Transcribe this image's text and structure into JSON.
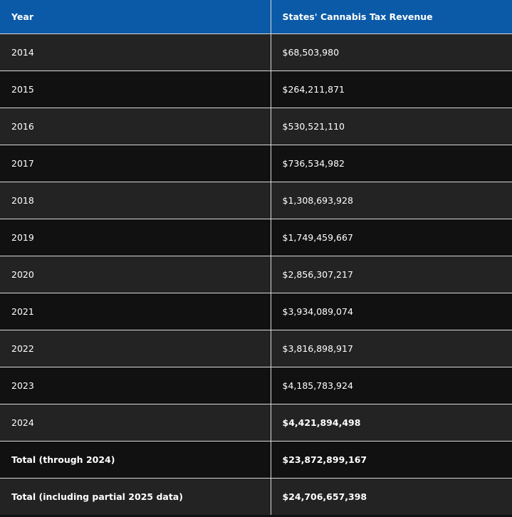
{
  "table": {
    "headers": [
      "Year",
      "States' Cannabis Tax Revenue"
    ],
    "rows": [
      {
        "year": "2014",
        "revenue": "$68,503,980",
        "bold_year": false,
        "bold_revenue": false
      },
      {
        "year": "2015",
        "revenue": "$264,211,871",
        "bold_year": false,
        "bold_revenue": false
      },
      {
        "year": "2016",
        "revenue": "$530,521,110",
        "bold_year": false,
        "bold_revenue": false
      },
      {
        "year": "2017",
        "revenue": "$736,534,982",
        "bold_year": false,
        "bold_revenue": false
      },
      {
        "year": "2018",
        "revenue": "$1,308,693,928",
        "bold_year": false,
        "bold_revenue": false
      },
      {
        "year": "2019",
        "revenue": "$1,749,459,667",
        "bold_year": false,
        "bold_revenue": false
      },
      {
        "year": "2020",
        "revenue": "$2,856,307,217",
        "bold_year": false,
        "bold_revenue": false
      },
      {
        "year": "2021",
        "revenue": "$3,934,089,074",
        "bold_year": false,
        "bold_revenue": false
      },
      {
        "year": "2022",
        "revenue": "$3,816,898,917",
        "bold_year": false,
        "bold_revenue": false
      },
      {
        "year": "2023",
        "revenue": "$4,185,783,924",
        "bold_year": false,
        "bold_revenue": false
      },
      {
        "year": "2024",
        "revenue": "$4,421,894,498",
        "bold_year": false,
        "bold_revenue": true
      },
      {
        "year": "Total (through 2024)",
        "revenue": "$23,872,899,167",
        "bold_year": true,
        "bold_revenue": true
      },
      {
        "year": "Total (including partial 2025 data)",
        "revenue": "$24,706,657,398",
        "bold_year": true,
        "bold_revenue": true
      }
    ]
  },
  "colors": {
    "header_bg": "#0b5aa7",
    "row_dark": "#111111",
    "row_light": "#232323",
    "border": "#d9d9d9",
    "text": "#ffffff"
  }
}
